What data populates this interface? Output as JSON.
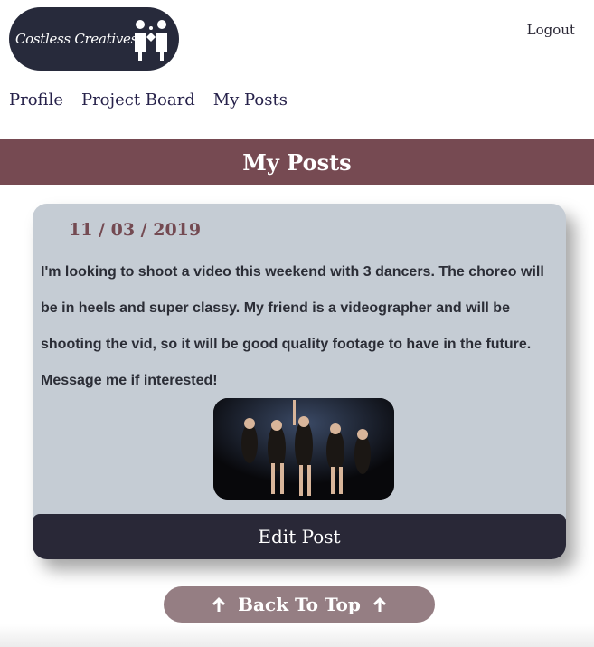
{
  "header": {
    "logo_text": "Costless Creatives",
    "logout_label": "Logout"
  },
  "nav": {
    "items": [
      {
        "label": "Profile"
      },
      {
        "label": "Project Board"
      },
      {
        "label": "My Posts"
      }
    ]
  },
  "banner": {
    "title": "My Posts"
  },
  "post": {
    "date": "11 / 03 / 2019",
    "text": "I'm looking to shoot a video this weekend with 3 dancers. The choreo will be in heels and super classy. My friend is a videographer and will be shooting the vid, so it will be good quality footage to have in the future. Message me if interested!",
    "image_icon": "dancers-photo",
    "edit_label": "Edit Post"
  },
  "back_to_top": {
    "label": "Back To Top",
    "icon": "arrow-up-icon"
  },
  "colors": {
    "logo_bg": "#272a3b",
    "banner_bg": "#764a52",
    "card_bg": "#c5ccd4",
    "edit_bg": "#292837",
    "top_btn_bg": "#957e83"
  }
}
